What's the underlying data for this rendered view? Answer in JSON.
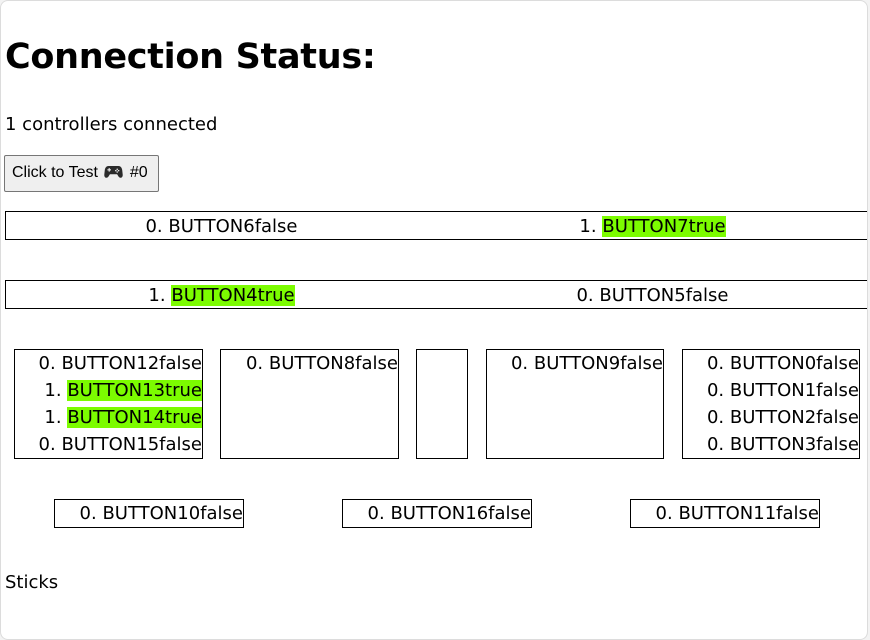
{
  "heading": "Connection Status:",
  "status_text": "1 controllers connected",
  "test_button": {
    "prefix": "Click to Test",
    "icon": "gamepad-icon",
    "suffix": "#0"
  },
  "highlight_color": "#7cfc00",
  "top_row": [
    {
      "index": "0.",
      "name": "BUTTON6false",
      "pressed": false
    },
    {
      "index": "1.",
      "name": "BUTTON7true",
      "pressed": true
    }
  ],
  "second_row": [
    {
      "index": "1.",
      "name": "BUTTON4true",
      "pressed": true
    },
    {
      "index": "0.",
      "name": "BUTTON5false",
      "pressed": false
    }
  ],
  "dpad_group": [
    {
      "index": "0.",
      "name": "BUTTON12false",
      "pressed": false
    },
    {
      "index": "1.",
      "name": "BUTTON13true",
      "pressed": true
    },
    {
      "index": "1.",
      "name": "BUTTON14true",
      "pressed": true
    },
    {
      "index": "0.",
      "name": "BUTTON15false",
      "pressed": false
    }
  ],
  "select_group": [
    {
      "index": "0.",
      "name": "BUTTON8false",
      "pressed": false
    }
  ],
  "start_group": [
    {
      "index": "0.",
      "name": "BUTTON9false",
      "pressed": false
    }
  ],
  "face_group": [
    {
      "index": "0.",
      "name": "BUTTON0false",
      "pressed": false
    },
    {
      "index": "0.",
      "name": "BUTTON1false",
      "pressed": false
    },
    {
      "index": "0.",
      "name": "BUTTON2false",
      "pressed": false
    },
    {
      "index": "0.",
      "name": "BUTTON3false",
      "pressed": false
    }
  ],
  "bottom_row": [
    {
      "index": "0.",
      "name": "BUTTON10false",
      "pressed": false
    },
    {
      "index": "0.",
      "name": "BUTTON16false",
      "pressed": false
    },
    {
      "index": "0.",
      "name": "BUTTON11false",
      "pressed": false
    }
  ],
  "sticks_label": "Sticks"
}
